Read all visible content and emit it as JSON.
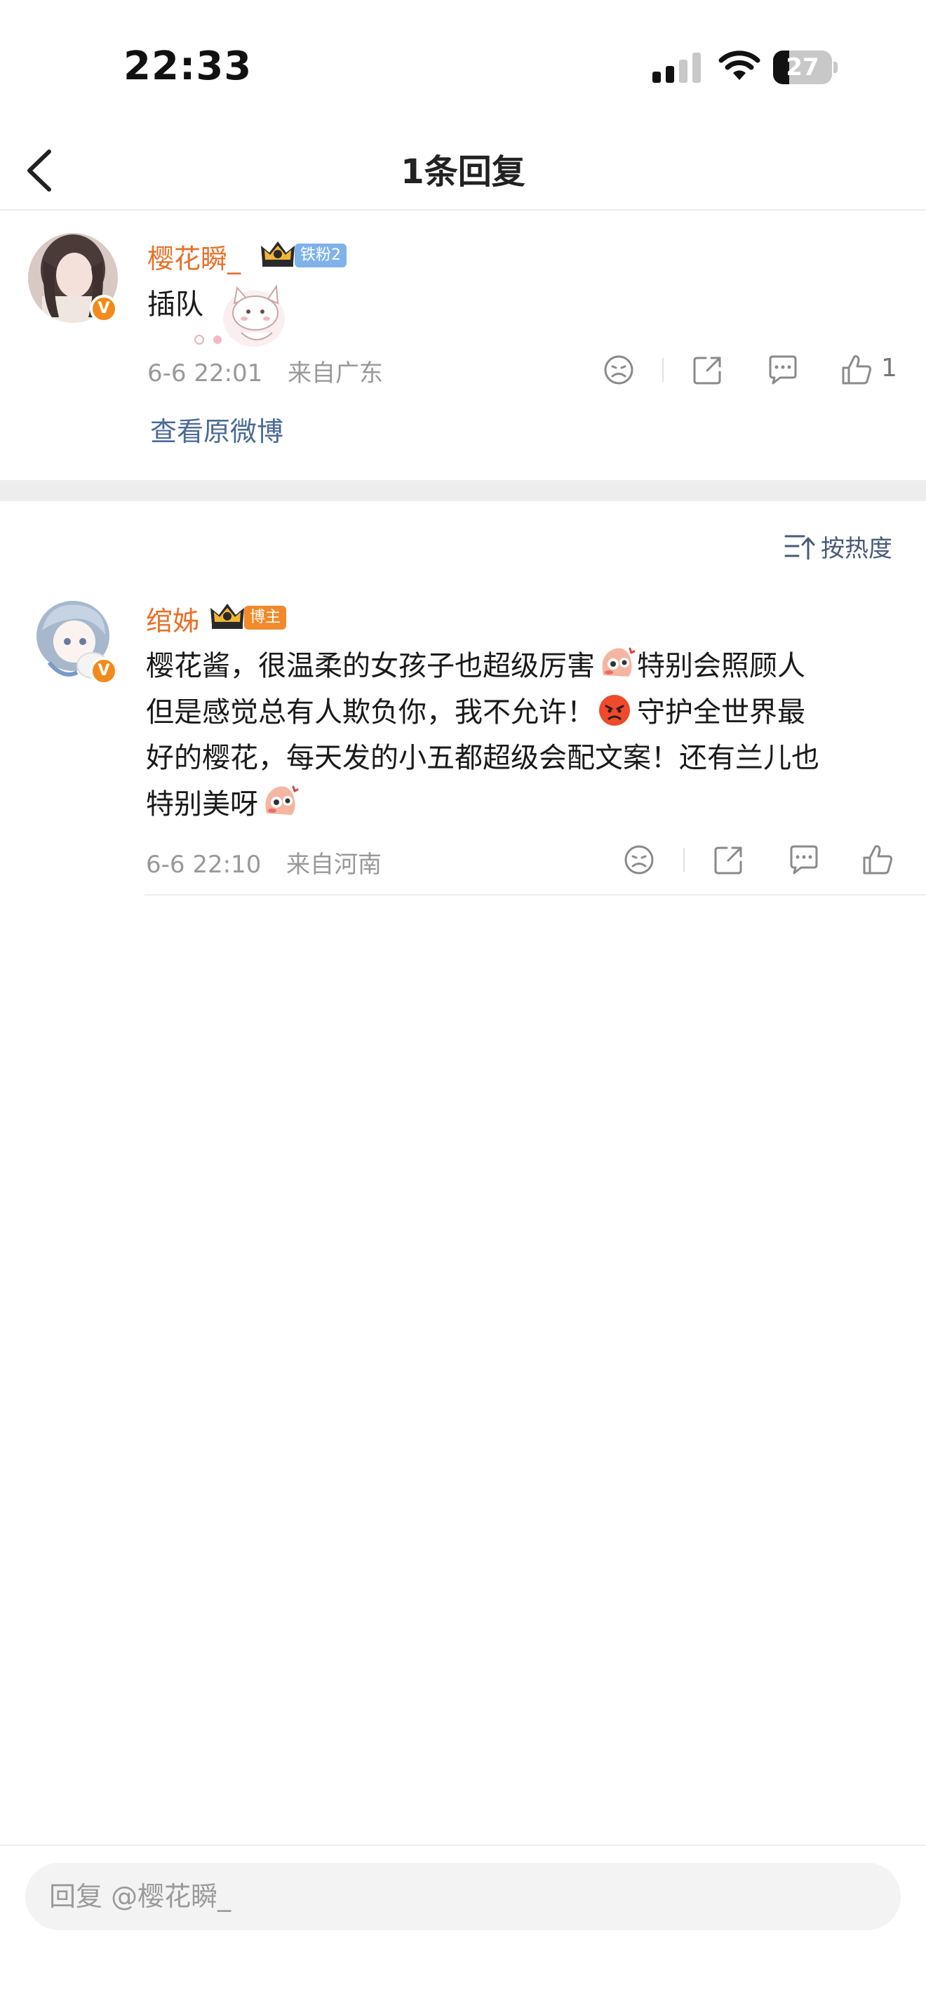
{
  "status_bar": {
    "time": "22:33",
    "battery_level": "27",
    "battery_fraction": 0.27,
    "icons": [
      "signal-icon",
      "wifi-icon",
      "battery-icon"
    ]
  },
  "nav": {
    "title": "1条回复",
    "back_icon": "chevron-left-icon"
  },
  "root_comment": {
    "username": "樱花瞬_",
    "fan_badge": "铁粉2",
    "text": "插队",
    "timestamp": "6-6 22:01",
    "location": "来自广东",
    "like_count": "1",
    "view_original": "查看原微博",
    "verified_icon": "verified-v-icon",
    "crown_icon": "crown-icon",
    "sticker_icon": "kitten-sticker-icon",
    "actions": [
      "dislike-face-icon",
      "share-icon",
      "comment-icon",
      "like-thumb-icon"
    ]
  },
  "sort": {
    "label": "按热度",
    "icon": "sort-icon"
  },
  "reply": {
    "username": "绾姊",
    "role_badge": "博主",
    "text_lines": [
      "樱花酱，很温柔的女孩子也超级厉害",
      "特别会照顾人",
      "但是感觉总有人欺负你，我不允许！",
      "守护全世界最",
      "好的樱花，每天发的小五都超级会配文案！还有兰儿也",
      "特别美呀"
    ],
    "timestamp": "6-6 22:10",
    "location": "来自河南",
    "emoji_icons": [
      "shy-emoji-icon",
      "angry-emoji-icon",
      "shy-emoji-icon"
    ],
    "actions": [
      "dislike-face-icon",
      "share-icon",
      "comment-icon",
      "like-thumb-icon"
    ]
  },
  "bottom": {
    "placeholder": "回复 @樱花瞬_"
  },
  "colors": {
    "username": "#e8702a",
    "link": "#4a6a9a",
    "meta": "#999999",
    "fan_badge": "#7fb2ea",
    "role_badge": "#f08a2a",
    "verified": "#f28b1b"
  }
}
